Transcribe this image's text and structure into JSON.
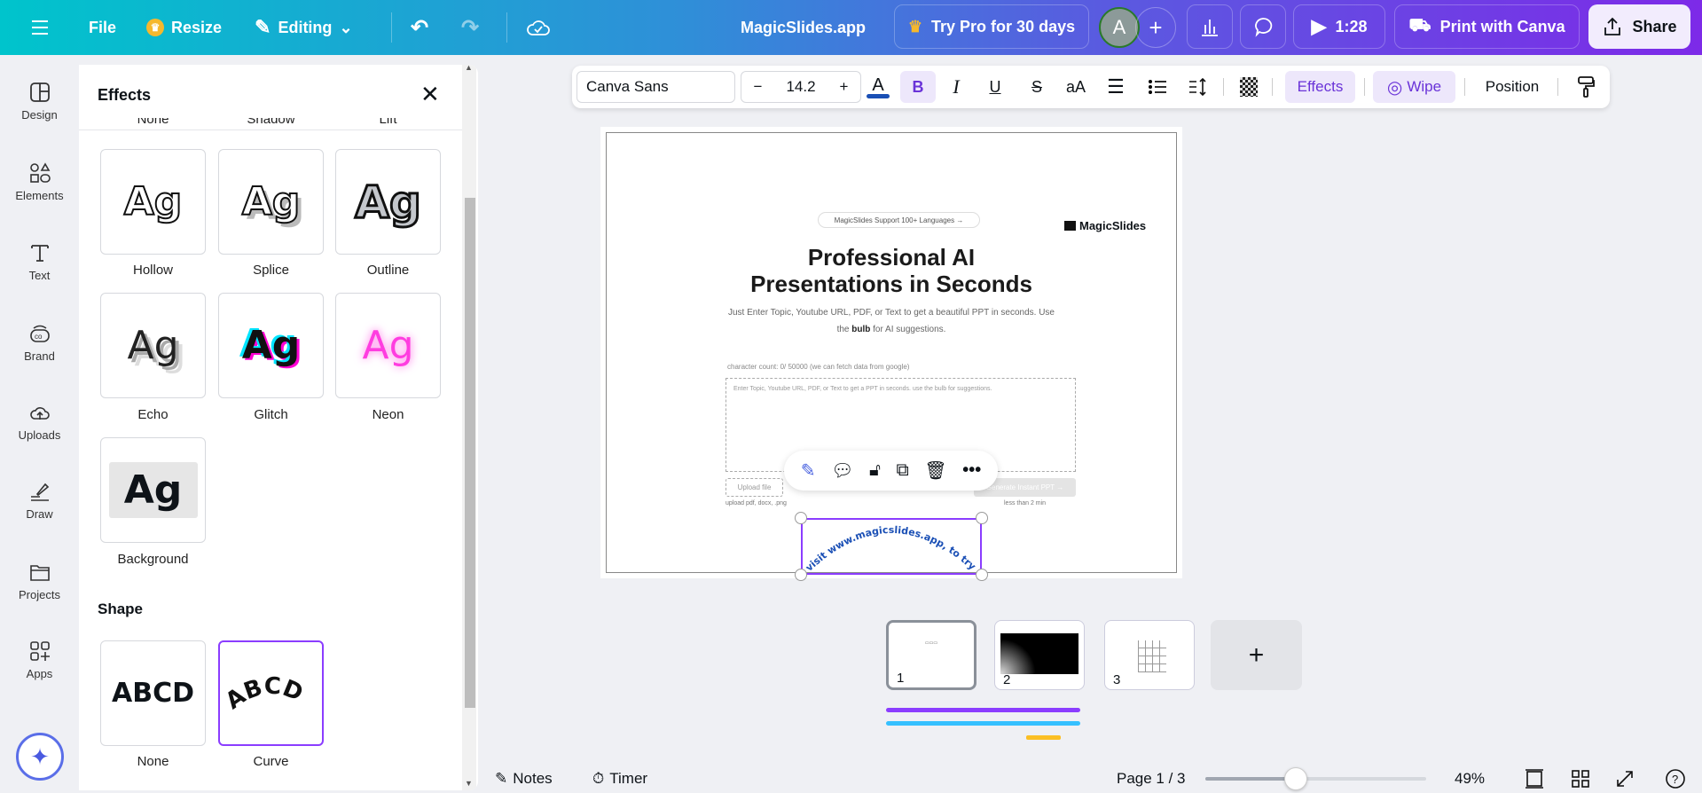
{
  "topbar": {
    "menu_icon": "hamburger-icon",
    "file": "File",
    "resize": "Resize",
    "editing": "Editing",
    "title": "MagicSlides.app",
    "try_pro": "Try Pro for 30 days",
    "avatar": "A",
    "play_time": "1:28",
    "print": "Print with Canva",
    "share": "Share"
  },
  "rail": {
    "items": [
      {
        "label": "Design",
        "icon": "layout-icon"
      },
      {
        "label": "Elements",
        "icon": "shapes-icon"
      },
      {
        "label": "Text",
        "icon": "text-icon"
      },
      {
        "label": "Brand",
        "icon": "brand-icon"
      },
      {
        "label": "Uploads",
        "icon": "cloud-upload-icon"
      },
      {
        "label": "Draw",
        "icon": "pen-icon"
      },
      {
        "label": "Projects",
        "icon": "folder-icon"
      },
      {
        "label": "Apps",
        "icon": "apps-icon"
      }
    ]
  },
  "panel": {
    "title": "Effects",
    "cut_labels": [
      "None",
      "Shadow",
      "Lift"
    ],
    "effects": [
      {
        "label": "Hollow",
        "sample": "Ag"
      },
      {
        "label": "Splice",
        "sample": "Ag"
      },
      {
        "label": "Outline",
        "sample": "Ag"
      },
      {
        "label": "Echo",
        "sample": "Ag"
      },
      {
        "label": "Glitch",
        "sample": "Ag"
      },
      {
        "label": "Neon",
        "sample": "Ag"
      },
      {
        "label": "Background",
        "sample": "Ag"
      }
    ],
    "shape_heading": "Shape",
    "shapes": [
      {
        "label": "None",
        "sample": "ABCD"
      },
      {
        "label": "Curve",
        "sample": "ABCD",
        "selected": true
      }
    ]
  },
  "toolbar": {
    "font": "Canva Sans",
    "size": "14.2",
    "minus": "−",
    "plus": "+",
    "color_glyph": "A",
    "bold": "B",
    "italic": "I",
    "underline": "U",
    "strike": "S",
    "case": "aA",
    "effects": "Effects",
    "wipe": "Wipe",
    "position": "Position",
    "text_color": "#1a4fb5"
  },
  "slide": {
    "badge": "MagicSlides Support 100+ Languages →",
    "logo": "MagicSlides",
    "title1": "Professional AI",
    "title2": "Presentations in Seconds",
    "subtitle1": "Just Enter Topic, Youtube URL, PDF, or Text to get a beautiful PPT in seconds. Use",
    "subtitle2_pre": "the ",
    "subtitle2_bold": "bulb",
    "subtitle2_post": " for AI suggestions.",
    "char_count": "character count: 0/ 50000 (we can fetch data from google)",
    "placeholder": "Enter Topic, Youtube URL, PDF, or Text to get a PPT in seconds. use the bulb for suggestions.",
    "upload": "Upload file",
    "upload_hint": "upload pdf, docx, .png",
    "generate": "Generate Instant PPT →",
    "time_hint": "less than 2 min",
    "curved_text": "visit www.magicslides.app, to try the app"
  },
  "pages": {
    "thumbs": [
      "1",
      "2",
      "3"
    ],
    "add": "+"
  },
  "bottom": {
    "notes": "Notes",
    "timer": "Timer",
    "page": "Page 1 / 3",
    "zoom": "49%",
    "zoom_fraction": 0.49
  }
}
